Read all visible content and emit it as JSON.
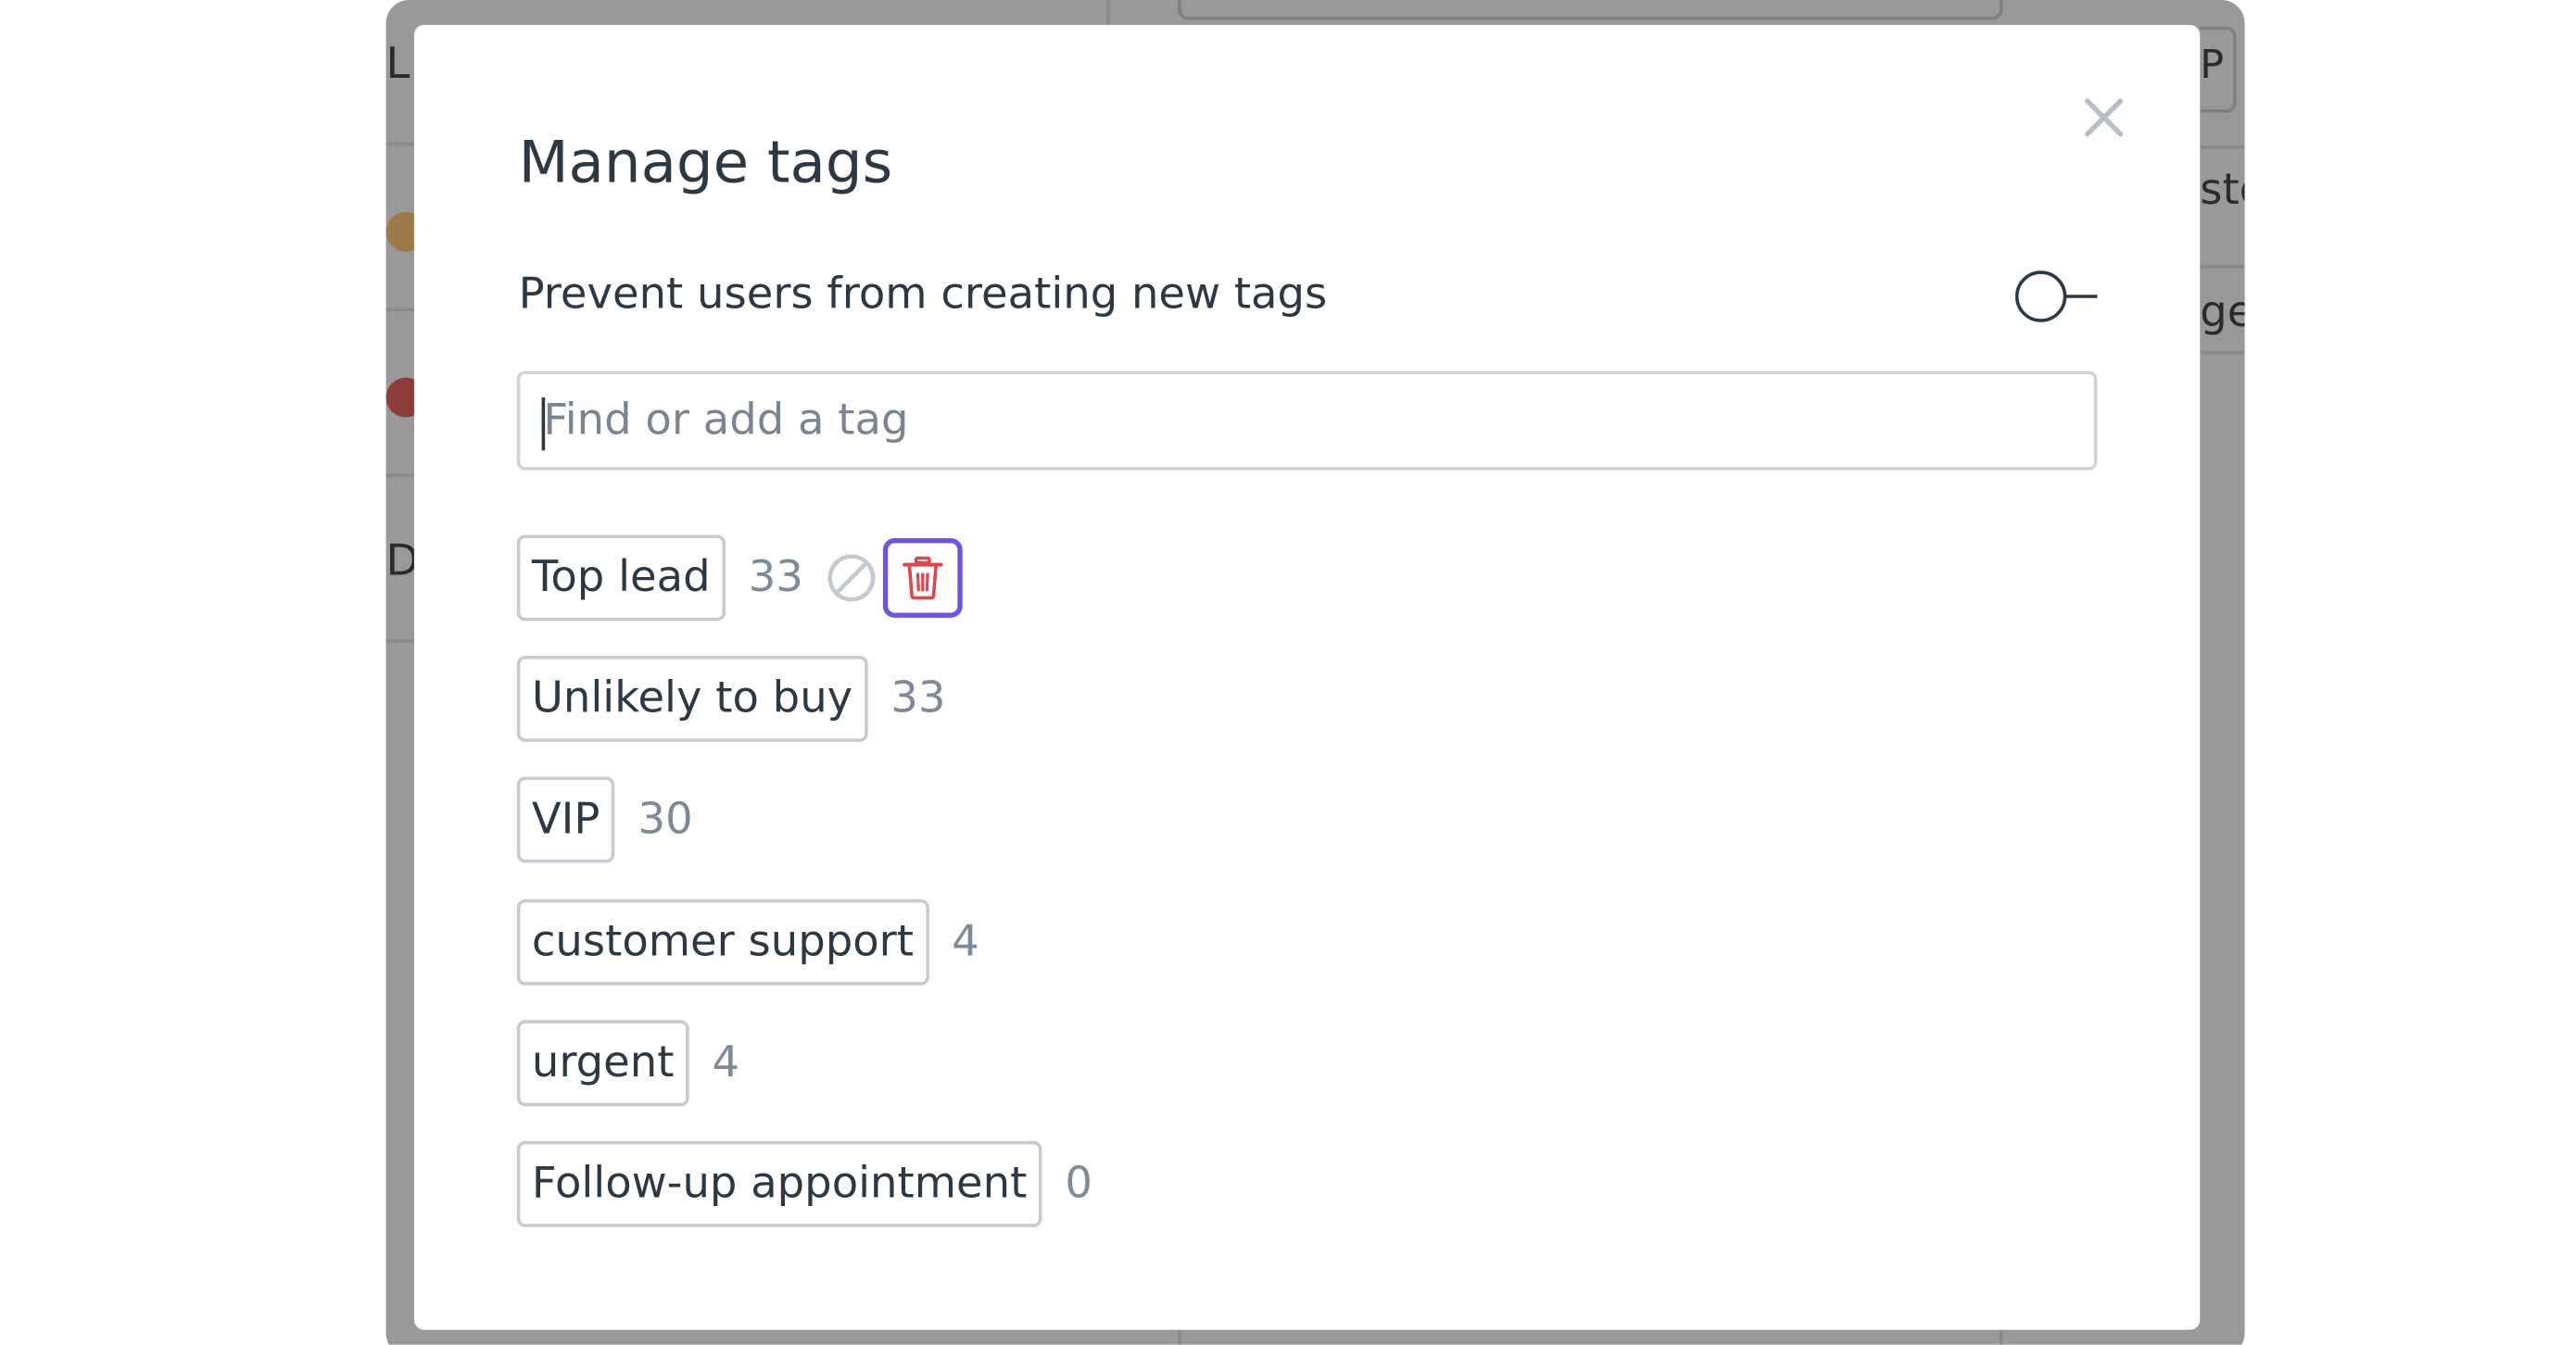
{
  "background": {
    "fragments": [
      "L",
      "D",
      "P",
      "sto",
      "ge"
    ]
  },
  "modal": {
    "title": "Manage tags",
    "close_icon": "close-icon",
    "setting": {
      "label": "Prevent users from creating new tags",
      "toggle_on": false
    },
    "search": {
      "placeholder": "Find or add a tag",
      "value": ""
    },
    "tags": [
      {
        "name": "Top lead",
        "count": "33",
        "show_actions": true
      },
      {
        "name": "Unlikely to buy",
        "count": "33"
      },
      {
        "name": "VIP",
        "count": "30"
      },
      {
        "name": "customer support",
        "count": "4"
      },
      {
        "name": "urgent",
        "count": "4"
      },
      {
        "name": "Follow-up appointment",
        "count": "0"
      }
    ],
    "action_icons": {
      "disable": "ban-icon",
      "delete": "trash-icon"
    }
  },
  "colors": {
    "overlay": "#999999",
    "text": "#2d3845",
    "muted": "#7d8a98",
    "focus_ring": "#6f52e8",
    "danger": "#e0474c"
  }
}
